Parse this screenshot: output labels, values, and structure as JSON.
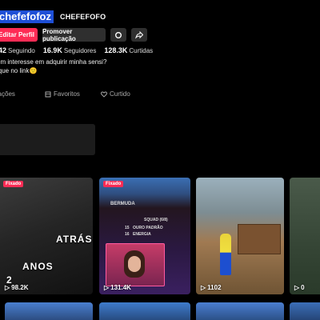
{
  "profile": {
    "username": "chefefofoz",
    "nickname": "CHEFEFOFO"
  },
  "buttons": {
    "edit": "Editar Perfil",
    "promote": "Promover publicação",
    "settings_icon": "settings-icon",
    "share_icon": "share-icon"
  },
  "stats": {
    "following_count": "42",
    "following_label": "Seguindo",
    "followers_count": "16.9K",
    "followers_label": "Seguidores",
    "likes_count": "128.3K",
    "likes_label": "Curtidas"
  },
  "bio": {
    "line1": "em interesse em adquirir minha sensi?",
    "line2": "ique no link",
    "emoji": "🙂"
  },
  "tabs": [
    {
      "label": "licações",
      "icon": "grid-icon"
    },
    {
      "label": "Favoritos",
      "icon": "bookmark-icon"
    },
    {
      "label": "Curtido",
      "icon": "heart-icon"
    }
  ],
  "videos": [
    {
      "badge": "Fixado",
      "views": "98.2K",
      "overlay_1": "ATRÁS",
      "overlay_2": "ANOS",
      "overlay_3": "2"
    },
    {
      "badge": "Fixado",
      "views": "131.4K",
      "map_label": "BERMUDA",
      "squad_label": "SQUAD (6/8)",
      "stat1_value": "15",
      "stat1_label": "OURO PADRÃO",
      "stat2_value": "16",
      "stat2_label": "ENERGIA"
    },
    {
      "views": "1102"
    },
    {
      "views": "0"
    }
  ],
  "colors": {
    "accent": "#fe2c55",
    "username_highlight": "#1e4fd6",
    "button_bg": "#2f2f2f"
  }
}
